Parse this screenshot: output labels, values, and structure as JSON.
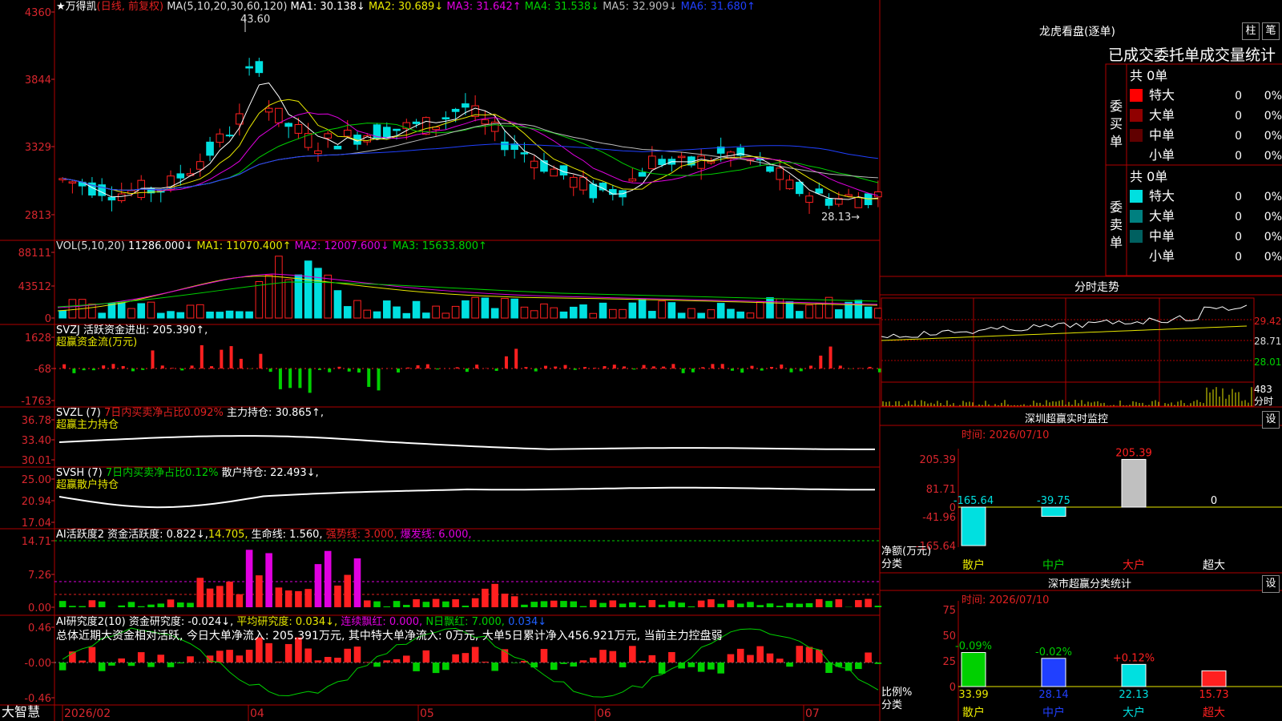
{
  "colors": {
    "up": "#ff2020",
    "down": "#00e0e0",
    "green": "#00d000",
    "yellow": "#e8e800",
    "magenta": "#e000e0",
    "white": "#ffffff",
    "frame": "#b00000",
    "axis": "#d8262d"
  },
  "main_header": {
    "title": "★万得凯",
    "subtitle": "(日线, 前复权)",
    "ma_label": "MA(5,10,20,30,60,120)",
    "ma1": "MA1: 30.138↓",
    "ma2": "MA2: 30.689↓",
    "ma3": "MA3: 31.642↑",
    "ma4": "MA4: 31.538↓",
    "ma5": "MA5: 32.909↓",
    "ma6": "MA6: 31.680↑",
    "high_label": "43.60",
    "low_label": "28.13"
  },
  "vol_header": {
    "label": "VOL(5,10,20)",
    "value": "11286.000↓",
    "ma1": "MA1: 11070.400↑",
    "ma2": "MA2: 12007.600↓",
    "ma3": "MA3: 15633.800↑"
  },
  "svzj_header": {
    "label": "SVZJ  活跃资金进出: 205.390↑,",
    "sub": "超赢资金流(万元)"
  },
  "svzl_header": {
    "label": "SVZL (7)",
    "ratio": "7日内买卖净占比0.092%",
    "hold": "主力持仓: 30.865↑,",
    "sub": "超赢主力持仓"
  },
  "svsh_header": {
    "label": "SVSH (7)",
    "ratio": "7日内买卖净占比0.12%",
    "hold": "散户持仓: 22.493↓,",
    "sub": "超赢散户持仓"
  },
  "ai1_header": {
    "label": "AI活跃度2",
    "v1": "资金活跃度: 0.822↓,",
    "v2": "14.705,",
    "v3": "生命线: 1.560,",
    "v4": "强势线: 3.000,",
    "v5": "爆发线: 6.000,"
  },
  "ai2_header": {
    "label": "AI研究度2(10)",
    "v1": "资金研究度: -0.024↓,",
    "v2": "平均研究度: 0.034↓,",
    "v3": "连续飘红: 0.000,",
    "v4": "N日飘红: 7.000,",
    "v5": "0.034↓"
  },
  "summary_text": "总体近期大资金相对活跃, 今日大单净流入: 205.391万元, 其中特大单净流入: 0万元, 大单5日累计净入456.921万元, 当前主力控盘弱",
  "x_axis": {
    "labels": [
      "2026/02",
      "04",
      "05",
      "06",
      "07"
    ],
    "corner": "大智慧"
  },
  "right": {
    "lhb_title": "龙虎看盘(逐单)",
    "btn_zhu": "柱",
    "btn_bi": "笔",
    "stat_title": "已成交委托单成交量统计",
    "buy": {
      "side": "委买单",
      "total": "共 0单",
      "rows": [
        {
          "name": "特大",
          "count": "0",
          "pct": "0%"
        },
        {
          "name": "大单",
          "count": "0",
          "pct": "0%"
        },
        {
          "name": "中单",
          "count": "0",
          "pct": "0%"
        },
        {
          "name": "小单",
          "count": "0",
          "pct": "0%"
        }
      ]
    },
    "sell": {
      "side": "委卖单",
      "total": "共 0单",
      "rows": [
        {
          "name": "特大",
          "count": "0",
          "pct": "0%"
        },
        {
          "name": "大单",
          "count": "0",
          "pct": "0%"
        },
        {
          "name": "中单",
          "count": "0",
          "pct": "0%"
        },
        {
          "name": "小单",
          "count": "0",
          "pct": "0%"
        }
      ]
    },
    "intraday_title": "分时走势",
    "intraday_price_labels": [
      "29.42",
      "28.71",
      "28.01"
    ],
    "intraday_vol_label": "483",
    "intraday_time_label": "分时",
    "sz_monitor": {
      "title": "深圳超赢实时监控",
      "btn": "设",
      "time": "时间: 2026/07/10",
      "y_labels": [
        "205.39",
        "81.71",
        "0",
        "-41.96",
        "-165.64"
      ],
      "unit_label": "净额(万元)",
      "cat_label": "分类"
    },
    "sz_class": {
      "title": "深市超赢分类统计",
      "btn": "设",
      "time": "时间: 2026/07/10",
      "y_labels": [
        "75",
        "50",
        "25",
        "0"
      ],
      "ratio_label": "比例%",
      "cat_label": "分类"
    }
  },
  "chart_data": [
    {
      "type": "candlestick",
      "title": "万得凯 日线 前复权",
      "y_ticks": [
        "4360",
        "3844",
        "3329",
        "2813"
      ],
      "ylim": [
        2750,
        4380
      ],
      "ma_periods": [
        5,
        10,
        20,
        30,
        60,
        120
      ],
      "high": 43.6,
      "low": 28.13,
      "note_scale": "price axis labels printed x100"
    },
    {
      "type": "bar",
      "title": "VOL(5,10,20)",
      "y_ticks": [
        "88111",
        "43512",
        "0"
      ],
      "ylim": [
        0,
        92000
      ]
    },
    {
      "type": "bar",
      "title": "SVZJ 超赢资金流(万元)",
      "y_ticks": [
        "1628",
        "-68",
        "-1763"
      ],
      "ylim": [
        -1800,
        1700
      ]
    },
    {
      "type": "line",
      "title": "SVZL 超赢主力持仓",
      "y_ticks": [
        "36.78",
        "33.40",
        "30.01"
      ],
      "ylim": [
        29.8,
        37.2
      ]
    },
    {
      "type": "line",
      "title": "SVSH 超赢散户持仓",
      "y_ticks": [
        "25.00",
        "20.94",
        "17.04"
      ],
      "ylim": [
        16.8,
        25.4
      ]
    },
    {
      "type": "bar",
      "title": "AI活跃度2",
      "y_ticks": [
        "14.71",
        "7.26",
        "0.00"
      ],
      "ylim": [
        0,
        15.5
      ]
    },
    {
      "type": "bar",
      "title": "AI研究度2(10)",
      "y_ticks": [
        "0.46",
        "-0.00",
        "-0.46"
      ],
      "ylim": [
        -0.5,
        0.5
      ]
    },
    {
      "type": "bar",
      "title": "深圳超赢实时监控",
      "categories": [
        "散户",
        "中户",
        "大户",
        "超大"
      ],
      "values": [
        -165.64,
        -39.75,
        205.39,
        0
      ]
    },
    {
      "type": "bar",
      "title": "深市超赢分类统计",
      "categories": [
        "散户",
        "中户",
        "大户",
        "超大"
      ],
      "values": [
        33.99,
        28.14,
        22.13,
        15.73
      ],
      "changes": [
        "-0.09%",
        "-0.02%",
        "+0.12%",
        ""
      ]
    }
  ]
}
